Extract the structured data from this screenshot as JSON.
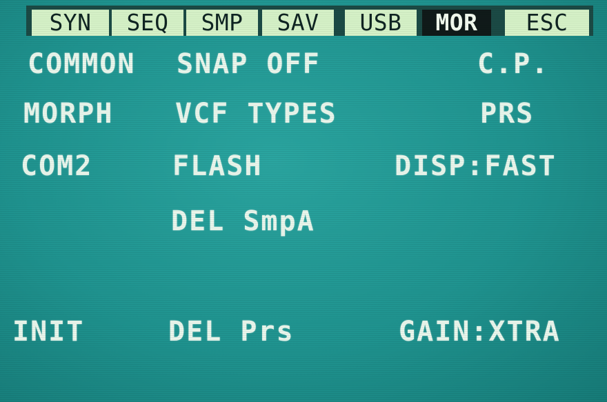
{
  "tabs": [
    {
      "label": "SYN",
      "active": false
    },
    {
      "label": "SEQ",
      "active": false
    },
    {
      "label": "SMP",
      "active": false
    },
    {
      "label": "SAV",
      "active": false
    },
    {
      "label": "USB",
      "active": false
    },
    {
      "label": "MOR",
      "active": true
    },
    {
      "label": "ESC",
      "active": false
    }
  ],
  "menu": {
    "common": "COMMON",
    "snap_off": "SNAP OFF",
    "cp": "C.P.",
    "morph": "MORPH",
    "vcf_types": "VCF TYPES",
    "prs": "PRS",
    "com2": "COM2",
    "flash": "FLASH",
    "disp": "DISP:FAST",
    "del_smpa": "DEL SmpA",
    "init": "INIT",
    "del_prs": "DEL Prs",
    "gain": "GAIN:XTRA"
  },
  "colors": {
    "screen": "#1f938f",
    "text": "#e9f6ec",
    "tab_bg": "#d6f2c8",
    "tab_active_bg": "#101a19"
  }
}
